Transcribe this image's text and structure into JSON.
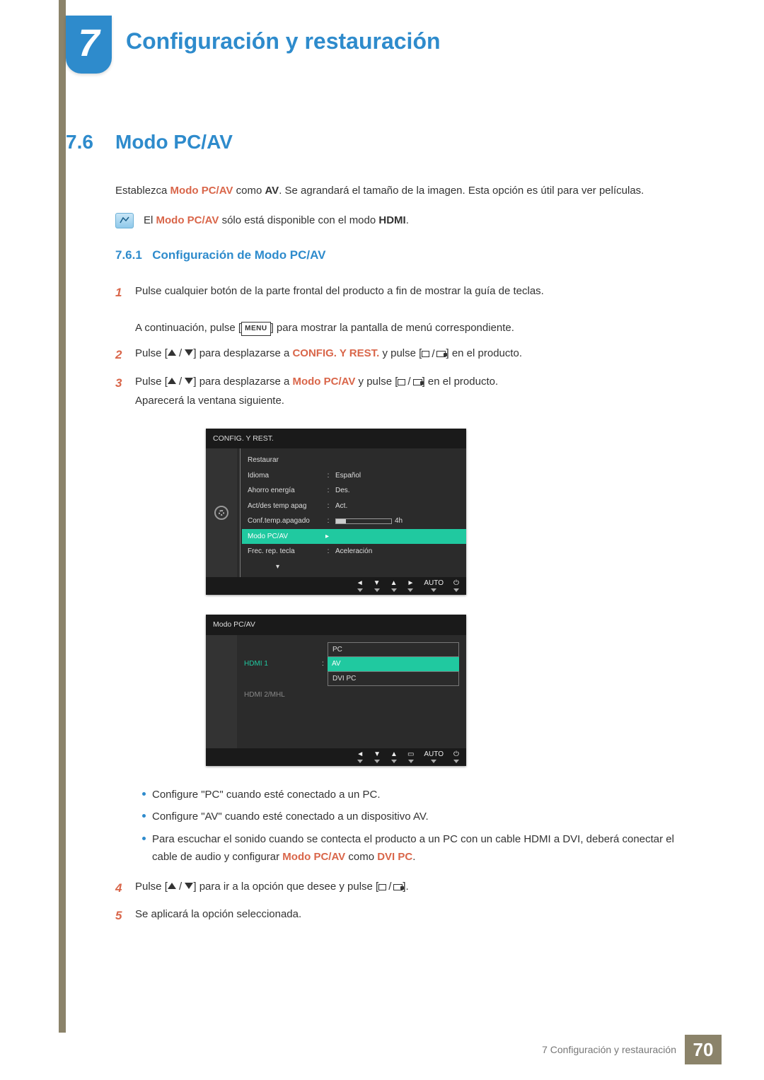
{
  "chapter": {
    "num": "7",
    "title": "Configuración y restauración"
  },
  "section": {
    "num": "7.6",
    "title": "Modo PC/AV"
  },
  "intro": {
    "t1": "Establezca ",
    "em1": "Modo PC/AV",
    "t2": " como ",
    "b1": "AV",
    "t3": ". Se agrandará el tamaño de la imagen. Esta opción es útil para ver películas."
  },
  "note": {
    "t1": "El ",
    "em1": "Modo PC/AV",
    "t2": " sólo está disponible con el modo ",
    "b1": "HDMI",
    "t3": "."
  },
  "subsection": {
    "num": "7.6.1",
    "title": "Configuración de Modo PC/AV"
  },
  "steps": {
    "s1a": "Pulse cualquier botón de la parte frontal del producto a fin de mostrar la guía de teclas.",
    "s1b_pre": "A continuación, pulse [",
    "s1b_menu": "MENU",
    "s1b_post": "] para mostrar la pantalla de menú correspondiente.",
    "s2_pre": "Pulse [",
    "s2_mid": "] para desplazarse a ",
    "s2_em": "CONFIG. Y REST.",
    "s2_post1": " y pulse [",
    "s2_post2": "] en el producto.",
    "s3_pre": "Pulse [",
    "s3_mid": "] para desplazarse a ",
    "s3_em": "Modo PC/AV",
    "s3_post1": " y pulse [",
    "s3_post2": "] en el producto.",
    "s3_after": "Aparecerá la ventana siguiente.",
    "s4_pre": "Pulse [",
    "s4_mid": "] para ir a la opción que desee y pulse [",
    "s4_post": "].",
    "s5": "Se aplicará la opción seleccionada."
  },
  "osd1": {
    "title": "CONFIG. Y REST.",
    "items": [
      {
        "label": "Restaurar",
        "value": ""
      },
      {
        "label": "Idioma",
        "value": "Español"
      },
      {
        "label": "Ahorro energía",
        "value": "Des."
      },
      {
        "label": "Act/des temp apag",
        "value": "Act."
      },
      {
        "label": "Conf.temp.apagado",
        "value": "",
        "slider": "4h"
      },
      {
        "label": "Modo PC/AV",
        "value": "",
        "selected": true
      },
      {
        "label": "Frec. rep. tecla",
        "value": "Aceleración"
      }
    ],
    "nav_auto": "AUTO"
  },
  "osd2": {
    "title": "Modo PC/AV",
    "rows": [
      {
        "label": "HDMI 1",
        "active": true,
        "opts": [
          "PC",
          "AV",
          "DVI PC"
        ],
        "sel": 1
      },
      {
        "label": "HDMI 2/MHL",
        "active": false
      }
    ],
    "nav_auto": "AUTO"
  },
  "bullets": {
    "b1": "Configure \"PC\" cuando esté conectado a un PC.",
    "b2": "Configure \"AV\" cuando esté conectado a un dispositivo AV.",
    "b3a": "Para escuchar el sonido cuando se contecta el producto a un PC con un cable HDMI a DVI, deberá conectar el cable de audio y configurar ",
    "b3em1": "Modo PC/AV",
    "b3mid": " como ",
    "b3em2": "DVI PC",
    "b3end": "."
  },
  "footer": {
    "text": "7 Configuración y restauración",
    "page": "70"
  }
}
